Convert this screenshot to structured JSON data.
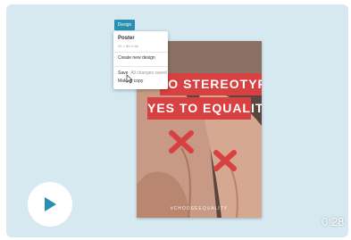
{
  "poster": {
    "line1": "TO STEREOTYPES",
    "line2": "YES TO EQUALITY",
    "hashtag": "#CHOOSEEQUALITY",
    "accent_color": "#d84141"
  },
  "menu": {
    "tag_label": "Design",
    "title": "Poster",
    "subtitle": "42 × 59.4 cm",
    "items": [
      {
        "label": "Create new design",
        "hint": ""
      },
      {
        "label": "Save",
        "hint": "All changes saved"
      },
      {
        "label": "Make a copy",
        "hint": ""
      }
    ]
  },
  "player": {
    "play_icon": "play-icon",
    "duration": "0:28",
    "accent_color": "#2a8fb0"
  }
}
